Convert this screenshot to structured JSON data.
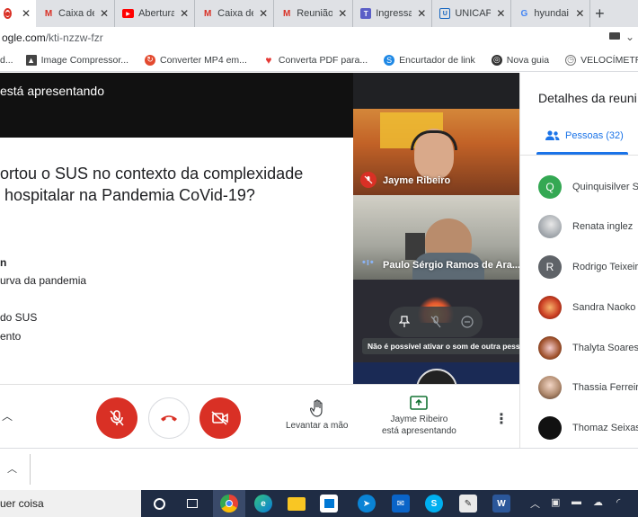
{
  "browser": {
    "tabs": [
      {
        "label": "",
        "icon": "record-icon",
        "color": "#d93025",
        "active": true
      },
      {
        "label": "Caixa de e",
        "icon": "gmail-icon",
        "color": "#d93025"
      },
      {
        "label": "Abertura d",
        "icon": "youtube-icon",
        "color": "#ff0000"
      },
      {
        "label": "Caixa de e",
        "icon": "gmail-icon",
        "color": "#d93025"
      },
      {
        "label": "Reunião -",
        "icon": "gmail-icon",
        "color": "#d93025"
      },
      {
        "label": "Ingressar",
        "icon": "teams-icon",
        "color": "#5b5fc7"
      },
      {
        "label": "UNICAP: o",
        "icon": "unicap-icon",
        "color": "#1565c0"
      },
      {
        "label": "hyundai c",
        "icon": "google-icon",
        "color": "#4285f4"
      }
    ],
    "new_tab": "+",
    "url_domain": "ogle.com",
    "url_path": "/kti-nzzw-fzr",
    "bookmarks": [
      {
        "label": "d...",
        "icon": "",
        "color": "#ffffff"
      },
      {
        "label": "Image Compressor...",
        "icon": "image-icon",
        "color": "#444444"
      },
      {
        "label": "Converter MP4 em...",
        "icon": "converter-icon",
        "color": "#e34a2f"
      },
      {
        "label": "Converta PDF para...",
        "icon": "heart-icon",
        "color": "#e53935"
      },
      {
        "label": "Encurtador de link",
        "icon": "link-icon",
        "color": "#1e88e5"
      },
      {
        "label": "Nova guia",
        "icon": "globe-icon",
        "color": "#333333"
      },
      {
        "label": "VELOCÍMETRO - Te...",
        "icon": "speed-icon",
        "color": "#777777"
      }
    ]
  },
  "meet": {
    "presenting_banner": "está apresentando",
    "slide": {
      "line1": "ortou o SUS no contexto da complexidade",
      "line2": " hospitalar na Pandemia CoVid-19?",
      "bullets": [
        "n",
        "urva da pandemia",
        "do SUS",
        "ento"
      ]
    },
    "tiles": [
      {
        "name": "Jayme Ribeiro",
        "muted": true
      },
      {
        "name": "Paulo Sérgio Ramos de Ara...",
        "speaking": true
      },
      {
        "name": "",
        "tooltip": "Não é possível ativar o som de outra pessoa"
      }
    ],
    "controls": {
      "raise_hand": "Levantar a mão",
      "presenter_name": "Jayme Ribeiro",
      "presenter_status": "está apresentando"
    }
  },
  "panel": {
    "title": "Detalhes da reuni",
    "people_tab": "Pessoas (32)",
    "participants": [
      {
        "name": "Quinquisilver S",
        "initial": "Q",
        "color": "#34a853"
      },
      {
        "name": "Renata inglez",
        "initial": "",
        "color": "#9aa0a6"
      },
      {
        "name": "Rodrigo Teixeir",
        "initial": "R",
        "color": "#5f6368"
      },
      {
        "name": "Sandra Naoko",
        "initial": "",
        "color": "#8d2a12"
      },
      {
        "name": "Thalyta Soares",
        "initial": "",
        "color": "#7a4a2a"
      },
      {
        "name": "Thassia Ferreira",
        "initial": "",
        "color": "#b08a6e"
      },
      {
        "name": "Thomaz Seixas",
        "initial": "",
        "color": "#111111"
      }
    ]
  },
  "taskbar": {
    "search_text": "uer coisa"
  }
}
